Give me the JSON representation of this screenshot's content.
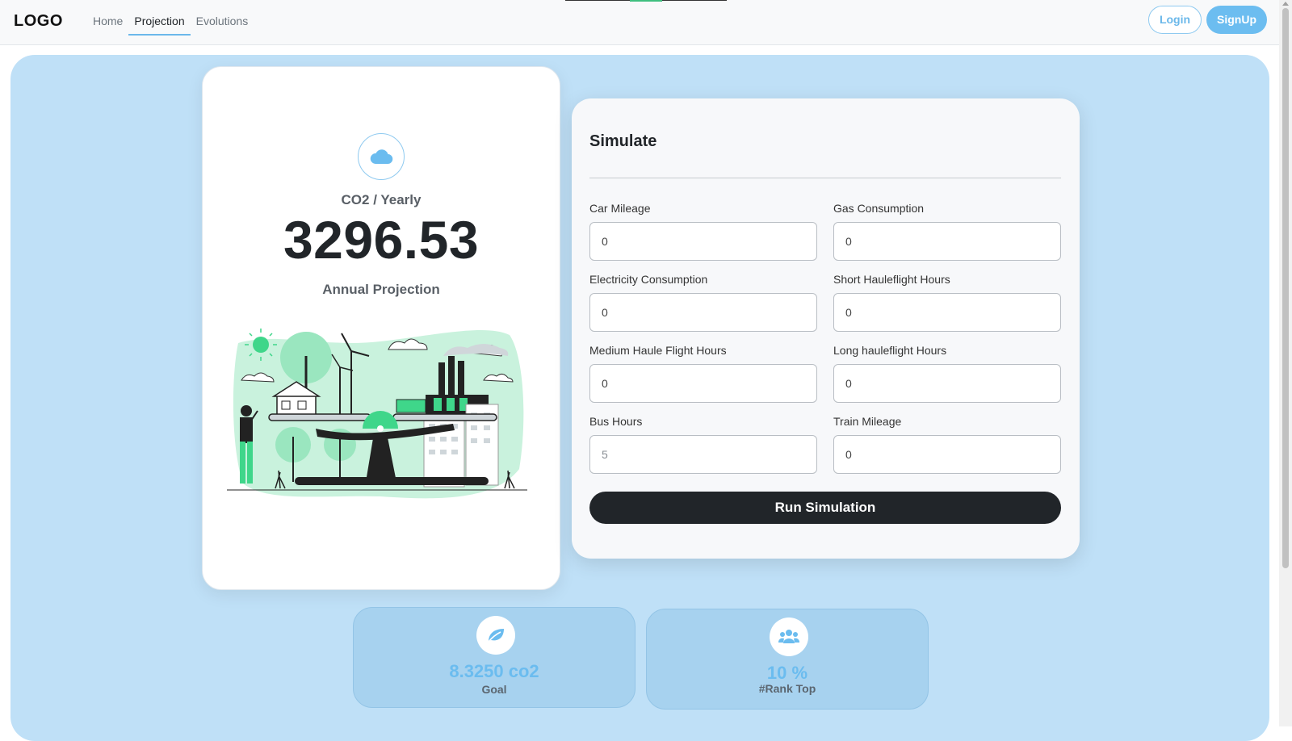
{
  "nav": {
    "brand": "LOGO",
    "links": [
      "Home",
      "Projection",
      "Evolutions"
    ],
    "active": "Projection",
    "login": "Login",
    "signup": "SignUp"
  },
  "projection": {
    "icon": "cloud-icon",
    "unit_label": "CO2 / Yearly",
    "value": "3296.53",
    "caption": "Annual Projection",
    "illustration": "scale-balance-eco-illustration"
  },
  "simulate": {
    "title": "Simulate",
    "fields": [
      {
        "label": "Car Mileage",
        "value": "0"
      },
      {
        "label": "Gas Consumption",
        "value": "0"
      },
      {
        "label": "Electricity Consumption",
        "value": "0"
      },
      {
        "label": "Short Hauleflight Hours",
        "value": "0"
      },
      {
        "label": "Medium Haule Flight Hours",
        "value": "0"
      },
      {
        "label": "Long hauleflight Hours",
        "value": "0"
      },
      {
        "label": "Bus Hours",
        "value": "5"
      },
      {
        "label": "Train Mileage",
        "value": "0"
      }
    ],
    "run_label": "Run Simulation"
  },
  "stats": {
    "goal": {
      "icon": "leaf-icon",
      "value": "8.3250 co2",
      "label": "Goal"
    },
    "rank": {
      "icon": "users-icon",
      "value": "10 %",
      "label": "#Rank Top"
    }
  },
  "colors": {
    "accent": "#6bbcef",
    "panel": "#bfe0f7",
    "dark": "#212529",
    "green": "#3fd68a"
  }
}
